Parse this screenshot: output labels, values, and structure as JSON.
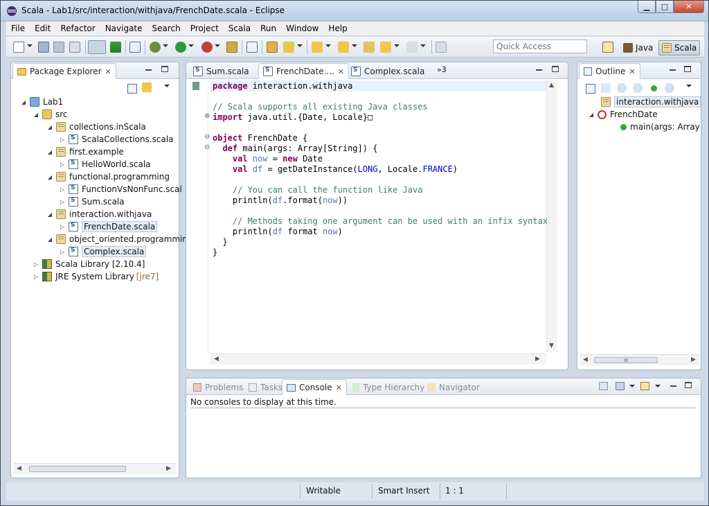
{
  "window": {
    "title": "Scala - Lab1/src/interaction/withjava/FrenchDate.scala - Eclipse",
    "controls": {
      "minimize": "▁",
      "maximize": "□",
      "close": "✕"
    }
  },
  "menu": [
    "File",
    "Edit",
    "Refactor",
    "Navigate",
    "Search",
    "Project",
    "Scala",
    "Run",
    "Window",
    "Help"
  ],
  "toolbar": {
    "quick_access_placeholder": "Quick Access",
    "perspectives": [
      {
        "label": "Java",
        "active": false
      },
      {
        "label": "Scala",
        "active": true
      }
    ]
  },
  "package_explorer": {
    "tab_label": "Package Explorer",
    "tree": [
      {
        "label": "Lab1",
        "icon": "project-icon",
        "twisty": "◢"
      },
      {
        "label": "src",
        "icon": "folder-icon",
        "twisty": "◢"
      },
      {
        "label": "collections.inScala",
        "icon": "package-icon",
        "twisty": "◢"
      },
      {
        "label": "ScalaCollections.scala",
        "icon": "scala-file-icon",
        "twisty": "▷"
      },
      {
        "label": "first.example",
        "icon": "package-icon",
        "twisty": "◢"
      },
      {
        "label": "HelloWorld.scala",
        "icon": "scala-file-icon",
        "twisty": "▷"
      },
      {
        "label": "functional.programming",
        "icon": "package-icon",
        "twisty": "◢"
      },
      {
        "label": "FunctionVsNonFunc.scal",
        "icon": "scala-file-icon",
        "twisty": "▷"
      },
      {
        "label": "Sum.scala",
        "icon": "scala-file-icon",
        "twisty": "▷"
      },
      {
        "label": "interaction.withjava",
        "icon": "package-icon",
        "twisty": "◢"
      },
      {
        "label": "FrenchDate.scala",
        "icon": "scala-file-icon",
        "twisty": "▷",
        "selected": true
      },
      {
        "label": "object_oriented.programmir",
        "icon": "package-icon",
        "twisty": "◢"
      },
      {
        "label": "Complex.scala",
        "icon": "scala-file-icon",
        "twisty": "▷",
        "selected": true
      },
      {
        "label": "Scala Library [2.10.4]",
        "icon": "library-icon",
        "twisty": "▷"
      },
      {
        "label": "JRE System Library",
        "suffix": "[jre7]",
        "icon": "library-icon",
        "twisty": "▷"
      }
    ]
  },
  "editor": {
    "tabs": [
      {
        "label": "Sum.scala",
        "active": false
      },
      {
        "label": "FrenchDate....",
        "active": true
      },
      {
        "label": "Complex.scala",
        "active": false
      }
    ],
    "overflow_label": "»3",
    "lines": [
      [
        {
          "t": "package ",
          "c": "kw"
        },
        {
          "t": "interaction.withjava",
          "c": "pk"
        }
      ],
      [],
      [
        {
          "t": "// Scala supports all existing Java classes",
          "c": "cm"
        }
      ],
      [
        {
          "t": "import ",
          "c": "kw"
        },
        {
          "t": "java.util.{Date, Locale}",
          "c": "pk"
        },
        {
          "t": "□",
          "c": "pk"
        }
      ],
      [],
      [
        {
          "t": "object ",
          "c": "kw"
        },
        {
          "t": "FrenchDate {",
          "c": "pk"
        }
      ],
      [
        {
          "t": "  def ",
          "c": "kw"
        },
        {
          "t": "main(args: Array[String]) {",
          "c": "pk"
        }
      ],
      [
        {
          "t": "    val ",
          "c": "kw"
        },
        {
          "t": "now",
          "c": "vr"
        },
        {
          "t": " = ",
          "c": "pk"
        },
        {
          "t": "new ",
          "c": "kw"
        },
        {
          "t": "Date",
          "c": "pk"
        }
      ],
      [
        {
          "t": "    val ",
          "c": "kw"
        },
        {
          "t": "df",
          "c": "vr"
        },
        {
          "t": " = getDateInstance(",
          "c": "pk"
        },
        {
          "t": "LONG",
          "c": "cn"
        },
        {
          "t": ", Locale.",
          "c": "pk"
        },
        {
          "t": "FRANCE",
          "c": "cn"
        },
        {
          "t": ")",
          "c": "pk"
        }
      ],
      [],
      [
        {
          "t": "    // You can call the function like Java",
          "c": "cm"
        }
      ],
      [
        {
          "t": "    println(",
          "c": "pk"
        },
        {
          "t": "df",
          "c": "vr"
        },
        {
          "t": ".format(",
          "c": "pk"
        },
        {
          "t": "now",
          "c": "vr"
        },
        {
          "t": "))",
          "c": "pk"
        }
      ],
      [],
      [
        {
          "t": "    // Methods taking one argument can be used with an infix syntax",
          "c": "cm"
        }
      ],
      [
        {
          "t": "    println(",
          "c": "pk"
        },
        {
          "t": "df",
          "c": "vr"
        },
        {
          "t": " format ",
          "c": "pk"
        },
        {
          "t": "now",
          "c": "vr"
        },
        {
          "t": ")",
          "c": "pk"
        }
      ],
      [
        {
          "t": "  }",
          "c": "pk"
        }
      ],
      [
        {
          "t": "}",
          "c": "pk"
        }
      ]
    ]
  },
  "outline": {
    "tab_label": "Outline",
    "items": [
      {
        "label": "interaction.withjava",
        "icon": "package-icon",
        "twisty": "",
        "selected": true
      },
      {
        "label": "FrenchDate",
        "icon": "object-icon",
        "twisty": "◢"
      },
      {
        "label": "main(args: Array",
        "icon": "method-icon",
        "twisty": ""
      }
    ],
    "scroll_thumb": "III"
  },
  "bottom": {
    "tabs": [
      {
        "label": "Problems",
        "active": false
      },
      {
        "label": "Tasks",
        "active": false
      },
      {
        "label": "Console",
        "active": true
      },
      {
        "label": "Type Hierarchy",
        "active": false
      },
      {
        "label": "Navigator",
        "active": false
      }
    ],
    "console_message": "No consoles to display at this time."
  },
  "statusbar": {
    "writable": "Writable",
    "insert_mode": "Smart Insert",
    "position": "1 : 1"
  },
  "colors": {
    "keyword": "#7f0055",
    "comment": "#3f7f5f",
    "variable": "#5a6fbf",
    "constant": "#0000c0"
  }
}
